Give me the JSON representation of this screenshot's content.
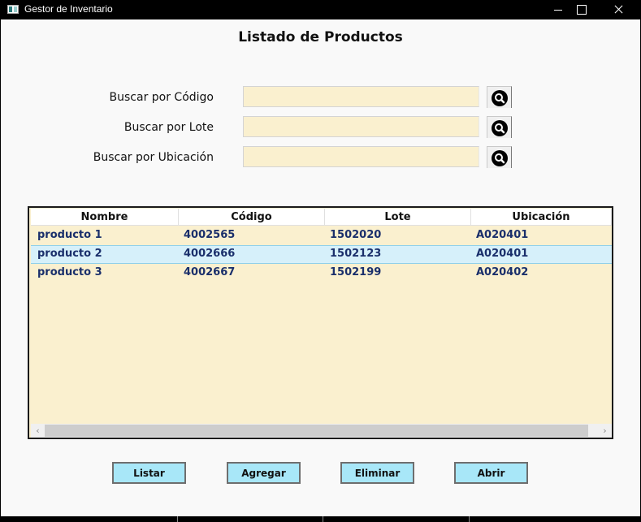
{
  "window": {
    "title": "Gestor de Inventario",
    "icon": "app-window-icon"
  },
  "page": {
    "title": "Listado de Productos"
  },
  "search": [
    {
      "label": "Buscar por Código",
      "value": "",
      "button_icon": "search-icon"
    },
    {
      "label": "Buscar por Lote",
      "value": "",
      "button_icon": "search-icon"
    },
    {
      "label": "Buscar por Ubicación",
      "value": "",
      "button_icon": "search-icon"
    }
  ],
  "table": {
    "columns": [
      "Nombre",
      "Código",
      "Lote",
      "Ubicación"
    ],
    "rows": [
      [
        "producto 1",
        "4002565",
        "1502020",
        "A020401"
      ],
      [
        "producto 2",
        "4002666",
        "1502123",
        "A020401"
      ],
      [
        "producto 3",
        "4002667",
        "1502199",
        "A020402"
      ]
    ],
    "selected_row": 1
  },
  "actions": {
    "list": "Listar",
    "add": "Agregar",
    "delete": "Eliminar",
    "open": "Abrir"
  },
  "colors": {
    "input_background": "#faf0cf",
    "button_background": "#a8e7f8",
    "row_text": "#1a2f6b",
    "selected_row": "#d6f0fa"
  }
}
